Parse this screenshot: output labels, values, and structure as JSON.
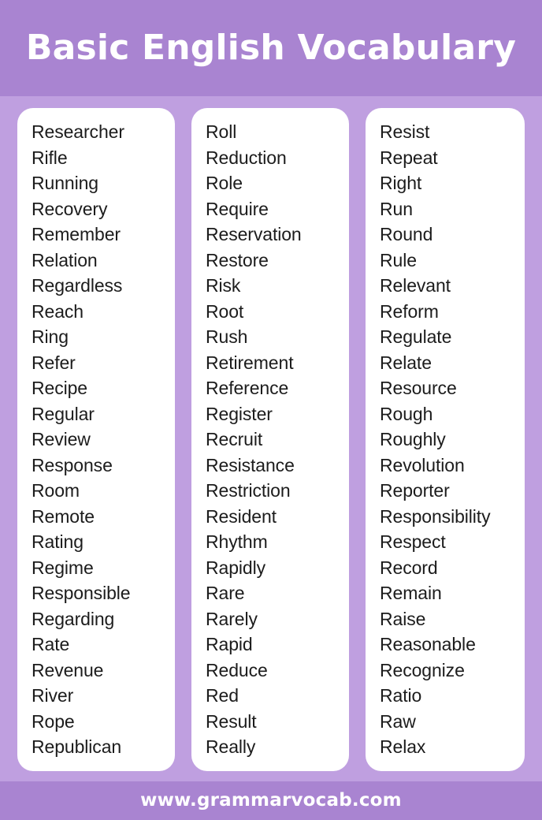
{
  "header": {
    "title": "Basic English Vocabulary",
    "background_color": "#a984d1",
    "text_color": "#ffffff"
  },
  "board": {
    "background_color": "#bf9fe0",
    "card_color": "#ffffff",
    "word_color": "#1c1c1c"
  },
  "columns": [
    {
      "id": "column-1",
      "words": [
        "Researcher",
        "Rifle",
        "Running",
        "Recovery",
        "Remember",
        "Relation",
        "Regardless",
        "Reach",
        "Ring",
        "Refer",
        "Recipe",
        "Regular",
        "Review",
        "Response",
        "Room",
        "Remote",
        "Rating",
        "Regime",
        "Responsible",
        "Regarding",
        "Rate",
        "Revenue",
        "River",
        "Rope",
        "Republican"
      ]
    },
    {
      "id": "column-2",
      "words": [
        "Roll",
        "Reduction",
        "Role",
        "Require",
        "Reservation",
        "Restore",
        "Risk",
        "Root",
        "Rush",
        "Retirement",
        "Reference",
        "Register",
        "Recruit",
        "Resistance",
        "Restriction",
        "Resident",
        "Rhythm",
        "Rapidly",
        "Rare",
        "Rarely",
        "Rapid",
        "Reduce",
        "Red",
        "Result",
        "Really"
      ]
    },
    {
      "id": "column-3",
      "words": [
        "Resist",
        "Repeat",
        "Right",
        "Run",
        "Round",
        "Rule",
        "Relevant",
        "Reform",
        "Regulate",
        "Relate",
        "Resource",
        "Rough",
        "Roughly",
        "Revolution",
        "Reporter",
        "Responsibility",
        "Respect",
        "Record",
        "Remain",
        "Raise",
        "Reasonable",
        "Recognize",
        "Ratio",
        "Raw",
        "Relax"
      ]
    }
  ],
  "footer": {
    "website": "www.grammarvocab.com",
    "background_color": "#a984d1",
    "text_color": "#ffffff"
  }
}
